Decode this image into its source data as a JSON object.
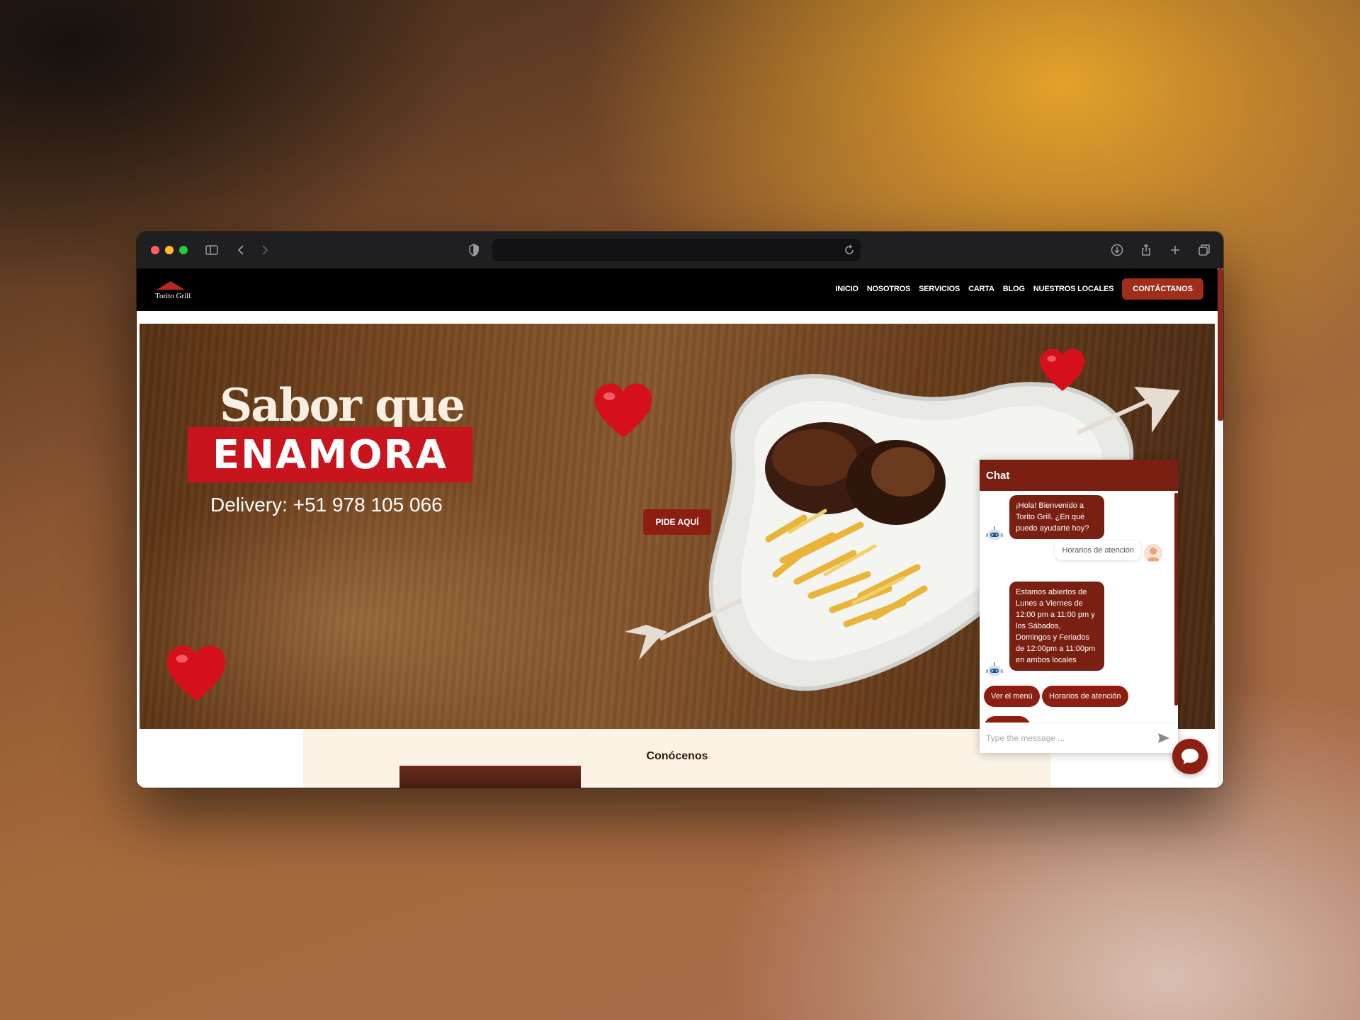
{
  "site": {
    "brand": "Torito Grill",
    "nav": [
      "INICIO",
      "NOSOTROS",
      "SERVICIOS",
      "CARTA",
      "BLOG",
      "NUESTROS LOCALES"
    ],
    "cta": "CONTÁCTANOS"
  },
  "hero": {
    "title": "Sabor que",
    "badge": "ENAMORA",
    "delivery": "Delivery: +51 978 105 066",
    "order_button": "PIDE AQUÍ"
  },
  "section": {
    "title": "Conócenos"
  },
  "chat": {
    "title": "Chat",
    "messages": [
      {
        "from": "bot",
        "text": "¡Hola! Bienvenido a Torito Grill. ¿En qué puedo ayudarte hoy?"
      },
      {
        "from": "user",
        "text": "Horarios de atención"
      },
      {
        "from": "bot",
        "text": "Estamos abiertos de Lunes a Viernes de 12:00 pm a 11:00 pm y los Sábados, Domingos y Feriados de 12:00pm a 11:00pm en ambos locales"
      }
    ],
    "quick_replies": [
      "Ver el menú",
      "Horarios de atención"
    ],
    "input_placeholder": "Type the message ..."
  },
  "colors": {
    "brand_red": "#8d1f12",
    "badge_red": "#c8141c",
    "nav_bg": "#000000"
  },
  "icons": [
    "sidebar-icon",
    "back-icon",
    "forward-icon",
    "shield-icon",
    "reload-icon",
    "download-icon",
    "share-icon",
    "new-tab-icon",
    "tabs-overview-icon",
    "bot-avatar-icon",
    "user-avatar-icon",
    "send-icon",
    "chat-bubble-icon"
  ]
}
